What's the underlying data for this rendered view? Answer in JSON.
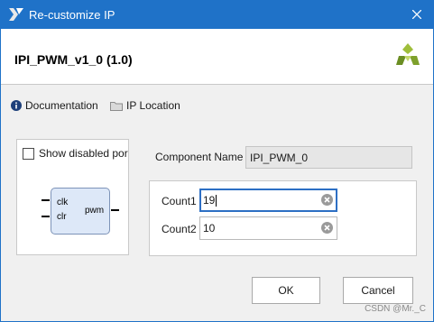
{
  "window": {
    "title": "Re-customize IP",
    "icon": "vivado-logo-icon",
    "close": "close-icon"
  },
  "header": {
    "ip_name": "IPI_PWM_v1_0 (1.0)",
    "brand_icon": "xilinx-logo-icon"
  },
  "links": {
    "documentation": {
      "label": "Documentation",
      "icon": "info-icon"
    },
    "ip_location": {
      "label": "IP Location",
      "icon": "folder-icon"
    }
  },
  "symbol_panel": {
    "show_disabled_ports": {
      "label": "Show disabled por",
      "checked": false
    },
    "block": {
      "inputs": [
        "clk",
        "clr"
      ],
      "outputs": [
        "pwm"
      ]
    }
  },
  "component": {
    "label": "Component Name",
    "value": "IPI_PWM_0"
  },
  "params": [
    {
      "label": "Count1",
      "value": "19",
      "focused": true
    },
    {
      "label": "Count2",
      "value": "10",
      "focused": false
    }
  ],
  "buttons": {
    "ok": "OK",
    "cancel": "Cancel"
  },
  "watermark": "CSDN @Mr._C",
  "colors": {
    "titlebar": "#1f72c8",
    "focus_border": "#2d6fc4",
    "block_fill": "#dde8f8",
    "brand_green": "#6b8e23"
  }
}
